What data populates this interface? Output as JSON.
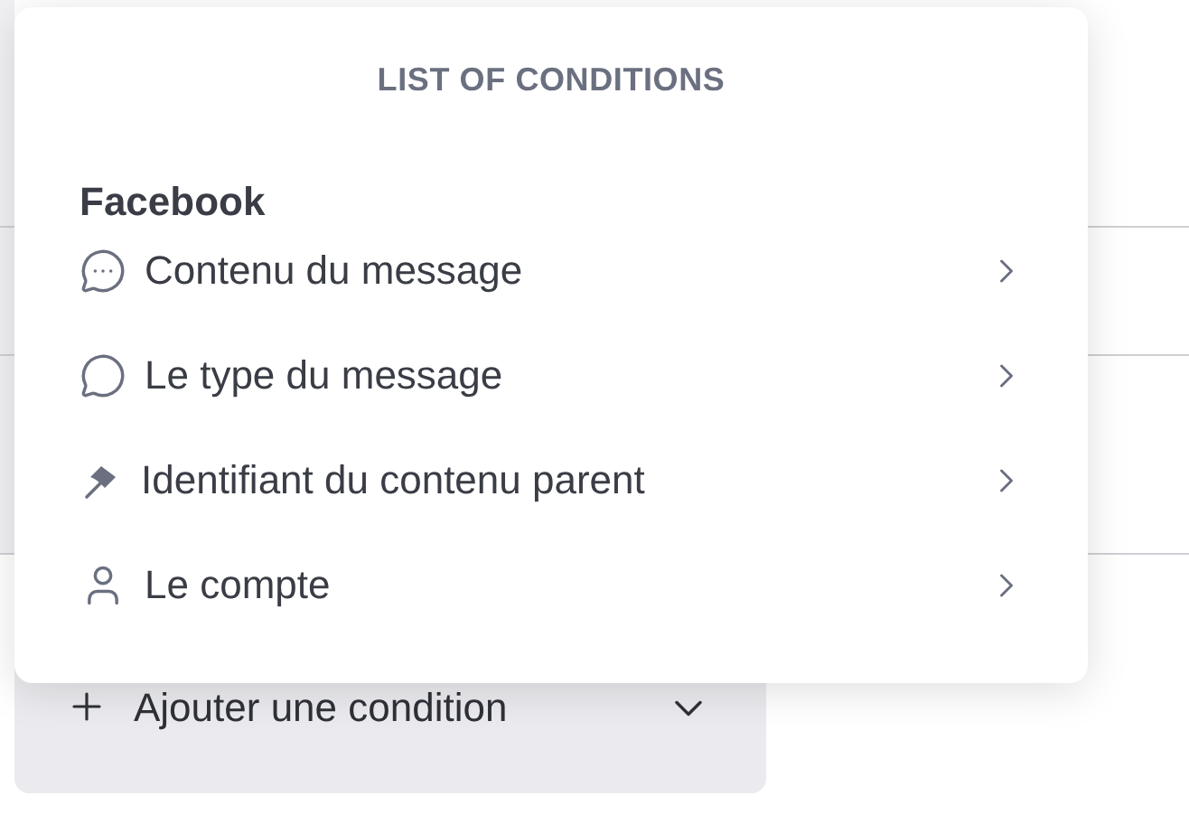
{
  "background": {
    "add_condition_button": {
      "label": "Ajouter une condition"
    }
  },
  "popup": {
    "title": "LIST OF CONDITIONS",
    "sections": [
      {
        "heading": "Facebook",
        "items": [
          {
            "label": "Contenu du message",
            "kind": "message-dots"
          },
          {
            "label": "Le type du message",
            "kind": "message"
          },
          {
            "label": "Identifiant du contenu parent",
            "kind": "flag"
          },
          {
            "label": "Le compte",
            "kind": "person"
          }
        ]
      }
    ]
  }
}
